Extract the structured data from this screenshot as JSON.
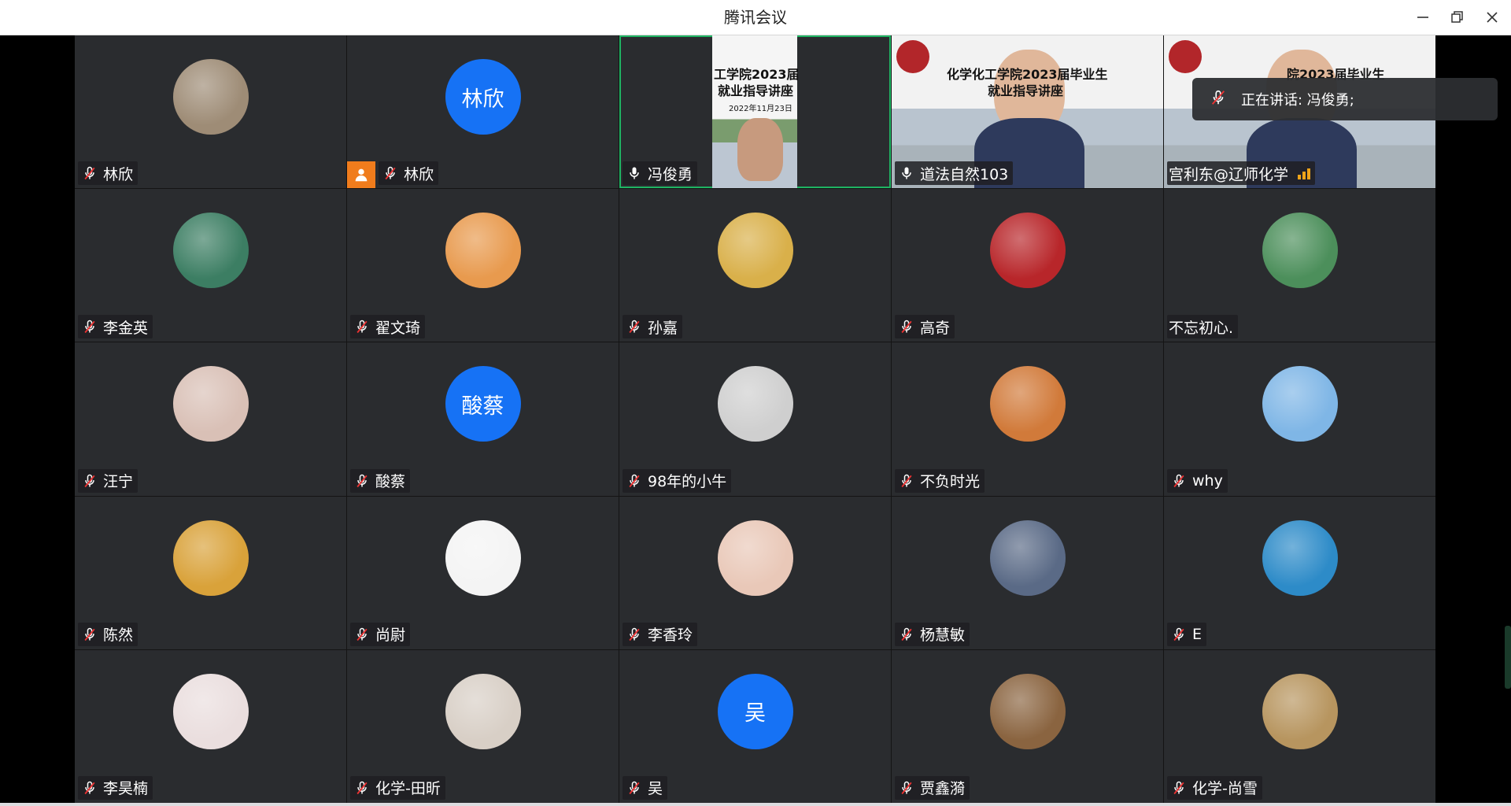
{
  "window": {
    "title": "腾讯会议",
    "minimize": "minimize",
    "restore": "restore",
    "close": "close"
  },
  "toast": {
    "speaking": "正在讲话: 冯俊勇;"
  },
  "slides": {
    "t3_line1": "工学院2023届",
    "t3_line2": "就业指导讲座",
    "t3_date": "2022年11月23日",
    "t4_line1": "化学化工学院2023届毕业生",
    "t4_line2": "就业指导讲座",
    "t5_line1": "院2023届毕业生"
  },
  "participants": [
    {
      "name": "林欣",
      "mic": "muted",
      "avatar": "photo",
      "color": "#9e8c76"
    },
    {
      "name": "林欣",
      "mic": "muted",
      "avatar": "text",
      "avatar_text": "林欣",
      "host": true
    },
    {
      "name": "冯俊勇",
      "mic": "on",
      "avatar": "video",
      "active": true
    },
    {
      "name": "道法自然103",
      "mic": "on",
      "avatar": "video"
    },
    {
      "name": "宫利东@辽师化学",
      "mic": "none",
      "avatar": "video",
      "signal": true
    },
    {
      "name": "李金英",
      "mic": "muted",
      "avatar": "photo",
      "color": "#3c7e63"
    },
    {
      "name": "翟文琦",
      "mic": "muted",
      "avatar": "photo",
      "color": "#e89a4e"
    },
    {
      "name": "孙嘉",
      "mic": "muted",
      "avatar": "photo",
      "color": "#d9b04a"
    },
    {
      "name": "高奇",
      "mic": "muted",
      "avatar": "photo",
      "color": "#b8262a"
    },
    {
      "name": "不忘初心.",
      "mic": "none",
      "avatar": "photo",
      "color": "#4c8f5b"
    },
    {
      "name": "汪宁",
      "mic": "muted",
      "avatar": "photo",
      "color": "#d9c0b6"
    },
    {
      "name": "酸蔡",
      "mic": "muted",
      "avatar": "text",
      "avatar_text": "酸蔡"
    },
    {
      "name": "98年的小牛",
      "mic": "muted",
      "avatar": "photo",
      "color": "#cfcfcf"
    },
    {
      "name": "不负时光",
      "mic": "muted",
      "avatar": "photo",
      "color": "#d17a3a"
    },
    {
      "name": "why",
      "mic": "muted",
      "avatar": "photo",
      "color": "#7fb6e6"
    },
    {
      "name": "陈然",
      "mic": "muted",
      "avatar": "photo",
      "color": "#d9a23a"
    },
    {
      "name": "尚尉",
      "mic": "muted",
      "avatar": "photo",
      "color": "#f4f4f4"
    },
    {
      "name": "李香玲",
      "mic": "muted",
      "avatar": "photo",
      "color": "#e9c8b8"
    },
    {
      "name": "杨慧敏",
      "mic": "muted",
      "avatar": "photo",
      "color": "#5a6a86"
    },
    {
      "name": "E",
      "mic": "muted",
      "avatar": "photo",
      "color": "#2d8bc8"
    },
    {
      "name": "李昊楠",
      "mic": "muted",
      "avatar": "photo",
      "color": "#eadede"
    },
    {
      "name": "化学-田昕",
      "mic": "muted",
      "avatar": "photo",
      "color": "#d8cfc6"
    },
    {
      "name": "吴",
      "mic": "muted",
      "avatar": "text",
      "avatar_text": "吴"
    },
    {
      "name": "贾鑫漪",
      "mic": "muted",
      "avatar": "photo",
      "color": "#8a6440"
    },
    {
      "name": "化学-尚雪",
      "mic": "muted",
      "avatar": "photo",
      "color": "#b7955f"
    }
  ]
}
